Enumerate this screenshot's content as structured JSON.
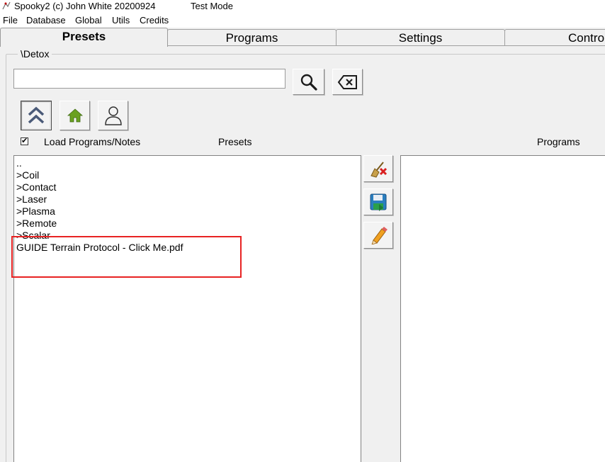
{
  "window": {
    "title": "Spooky2 (c) John White 20200924",
    "mode": "Test Mode"
  },
  "menu": [
    "File",
    "Database",
    "Global",
    "Utils",
    "Credits"
  ],
  "tabs": [
    {
      "label": "Presets",
      "active": true
    },
    {
      "label": "Programs",
      "active": false
    },
    {
      "label": "Settings",
      "active": false
    },
    {
      "label": "Control",
      "active": false
    }
  ],
  "group": {
    "title": "\\Detox"
  },
  "search": {
    "value": "",
    "placeholder": ""
  },
  "options": {
    "load_programs_notes": {
      "label": "Load Programs/Notes",
      "checked": true
    }
  },
  "presets": {
    "header": "Presets",
    "items": [
      "..",
      ">Coil",
      ">Contact",
      ">Laser",
      ">Plasma",
      ">Remote",
      ">Scalar",
      "GUIDE Terrain Protocol - Click Me.pdf"
    ]
  },
  "programs": {
    "header": "Programs",
    "items": []
  },
  "colors": {
    "highlight": "#e82323",
    "home_icon": "#6aa121",
    "window_bg": "#f0f0f0"
  }
}
